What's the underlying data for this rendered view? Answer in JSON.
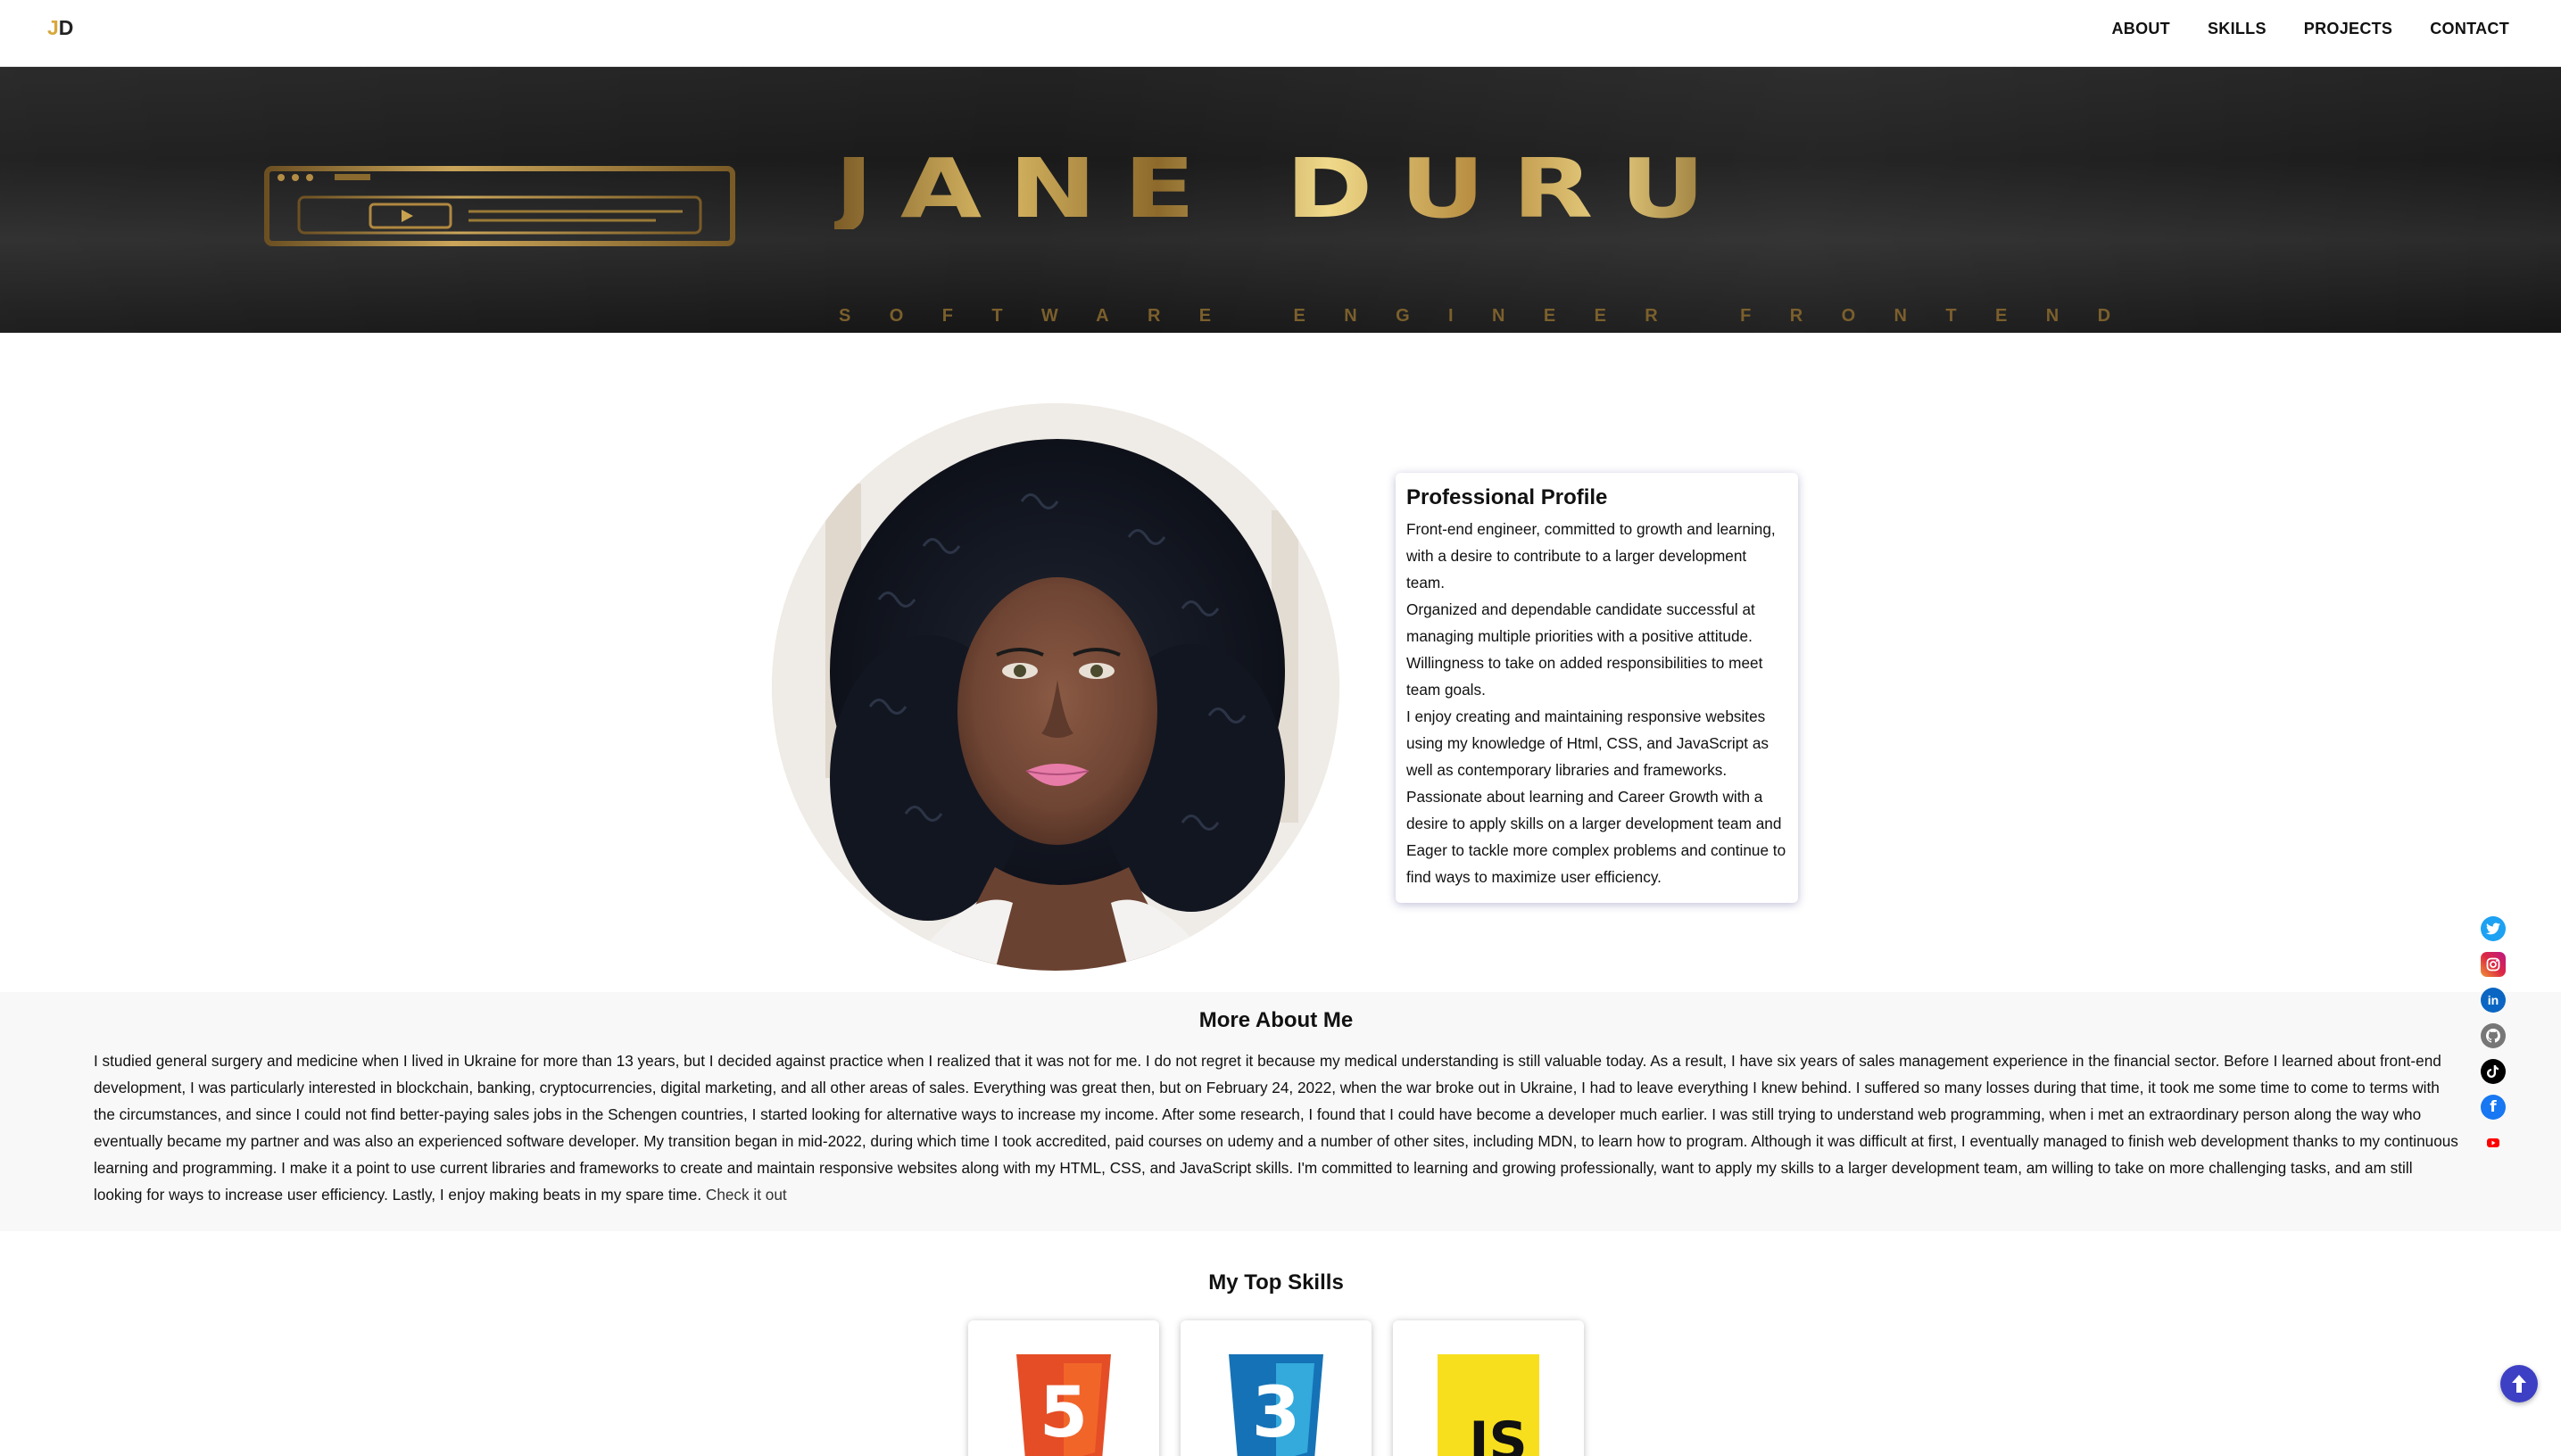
{
  "nav": {
    "logo_j": "J",
    "logo_d": "D",
    "links": [
      "ABOUT",
      "SKILLS",
      "PROJECTS",
      "CONTACT"
    ]
  },
  "banner": {
    "name": "JANE DURU",
    "subtitle": "SOFTWARE ENGINEER FRONTEND",
    "gold_color": "#c9a24f"
  },
  "profile": {
    "photo_icon": "profile-photo",
    "title": "Professional Profile",
    "paragraphs": [
      "Front-end engineer, committed to growth and learning, with a desire to contribute to a larger development team.",
      "Organized and dependable candidate successful at managing multiple priorities with a positive attitude. Willingness to take on added responsibilities to meet team goals.",
      "I enjoy creating and maintaining responsive websites using my knowledge of Html, CSS, and JavaScript as well as contemporary libraries and frameworks.",
      "Passionate about learning and Career Growth with a desire to apply skills on a larger development team and Eager to tackle more complex problems and continue to find ways to maximize user efficiency."
    ]
  },
  "about": {
    "title": "More About Me",
    "text": "I studied general surgery and medicine when I lived in Ukraine for more than 13 years, but I decided against practice when I realized that it was not for me. I do not regret it because my medical understanding is still valuable today. As a result, I have six years of sales management experience in the financial sector. Before I learned about front-end development, I was particularly interested in blockchain, banking, cryptocurrencies, digital marketing, and all other areas of sales. Everything was great then, but on February 24, 2022, when the war broke out in Ukraine, I had to leave everything I knew behind. I suffered so many losses during that time, it took me some time to come to terms with the circumstances, and since I could not find better-paying sales jobs in the Schengen countries, I started looking for alternative ways to increase my income. After some research, I found that I could have become a developer much earlier. I was still trying to understand web programming, when i met an extraordinary person along the way who eventually became my partner and was also an experienced software developer. My transition began in mid-2022, during which time I took accredited, paid courses on udemy and a number of other sites, including MDN, to learn how to program. Although it was difficult at first, I eventually managed to finish web development thanks to my continuous learning and programming. I make it a point to use current libraries and frameworks to create and maintain responsive websites along with my HTML, CSS, and JavaScript skills. I'm committed to learning and growing professionally, want to apply my skills to a larger development team, am willing to take on more challenging tasks, and am still looking for ways to increase user efficiency. Lastly, I enjoy making beats in my spare time.",
    "link": "Check it out"
  },
  "skills": {
    "title": "My Top Skills",
    "items": [
      {
        "name": "html5-icon",
        "label": "5",
        "color": "#e44d26"
      },
      {
        "name": "css3-icon",
        "label": "3",
        "color": "#1572b6"
      },
      {
        "name": "javascript-icon",
        "label": "JS",
        "color": "#f7df1e"
      }
    ]
  },
  "social": [
    {
      "name": "twitter-icon",
      "color": "#1da1f2"
    },
    {
      "name": "instagram-icon",
      "color": "#c13584"
    },
    {
      "name": "linkedin-icon",
      "color": "#0a66c2"
    },
    {
      "name": "github-icon",
      "color": "#555555"
    },
    {
      "name": "tiktok-icon",
      "color": "#000000"
    },
    {
      "name": "facebook-icon",
      "color": "#1877f2"
    },
    {
      "name": "youtube-icon",
      "color": "#ff0000"
    }
  ],
  "back_to_top": {
    "icon": "arrow-up-icon",
    "color": "#3d40c4"
  }
}
